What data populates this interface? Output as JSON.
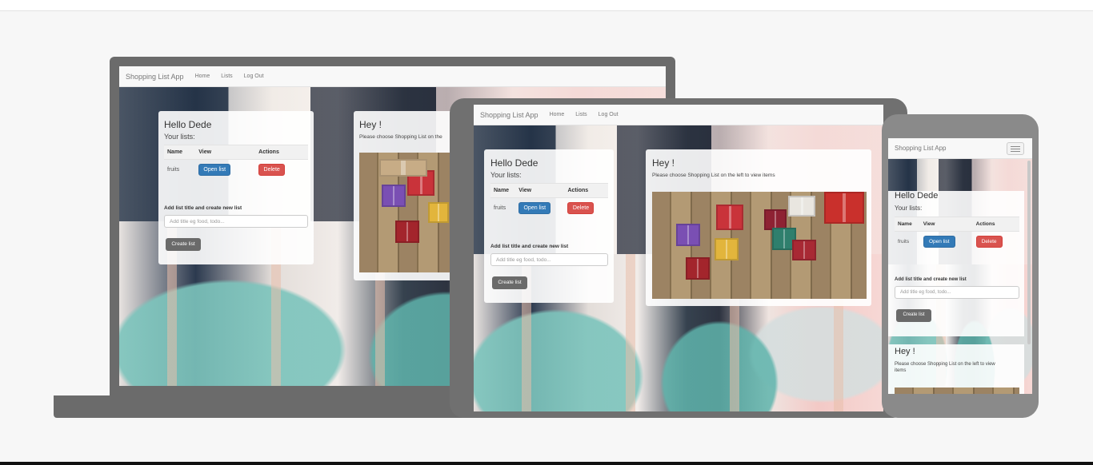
{
  "app": {
    "brand": "Shopping List App",
    "nav": [
      "Home",
      "Lists",
      "Log Out"
    ]
  },
  "lists_panel": {
    "greeting": "Hello Dede",
    "subtitle": "Your lists:",
    "columns": [
      "Name",
      "View",
      "Actions"
    ],
    "rows": [
      {
        "name": "fruits",
        "open_label": "Open list",
        "delete_label": "Delete"
      }
    ],
    "form_label": "Add list title and create new list",
    "input_placeholder": "Add title eg food, todo...",
    "create_label": "Create list"
  },
  "items_panel": {
    "title": "Hey !",
    "message_laptop": "Please choose Shopping List on the",
    "message": "Please choose Shopping List on the left to view items",
    "message_phone_line1": "Please choose Shopping List on the left to view",
    "message_phone_line2": "items"
  },
  "colors": {
    "primary": "#337ab7",
    "danger": "#d9534f",
    "create": "#6a6a6a",
    "frame": "#6b6b6b",
    "page_bg": "#f7f7f7"
  },
  "icons": [
    "menu-icon"
  ]
}
